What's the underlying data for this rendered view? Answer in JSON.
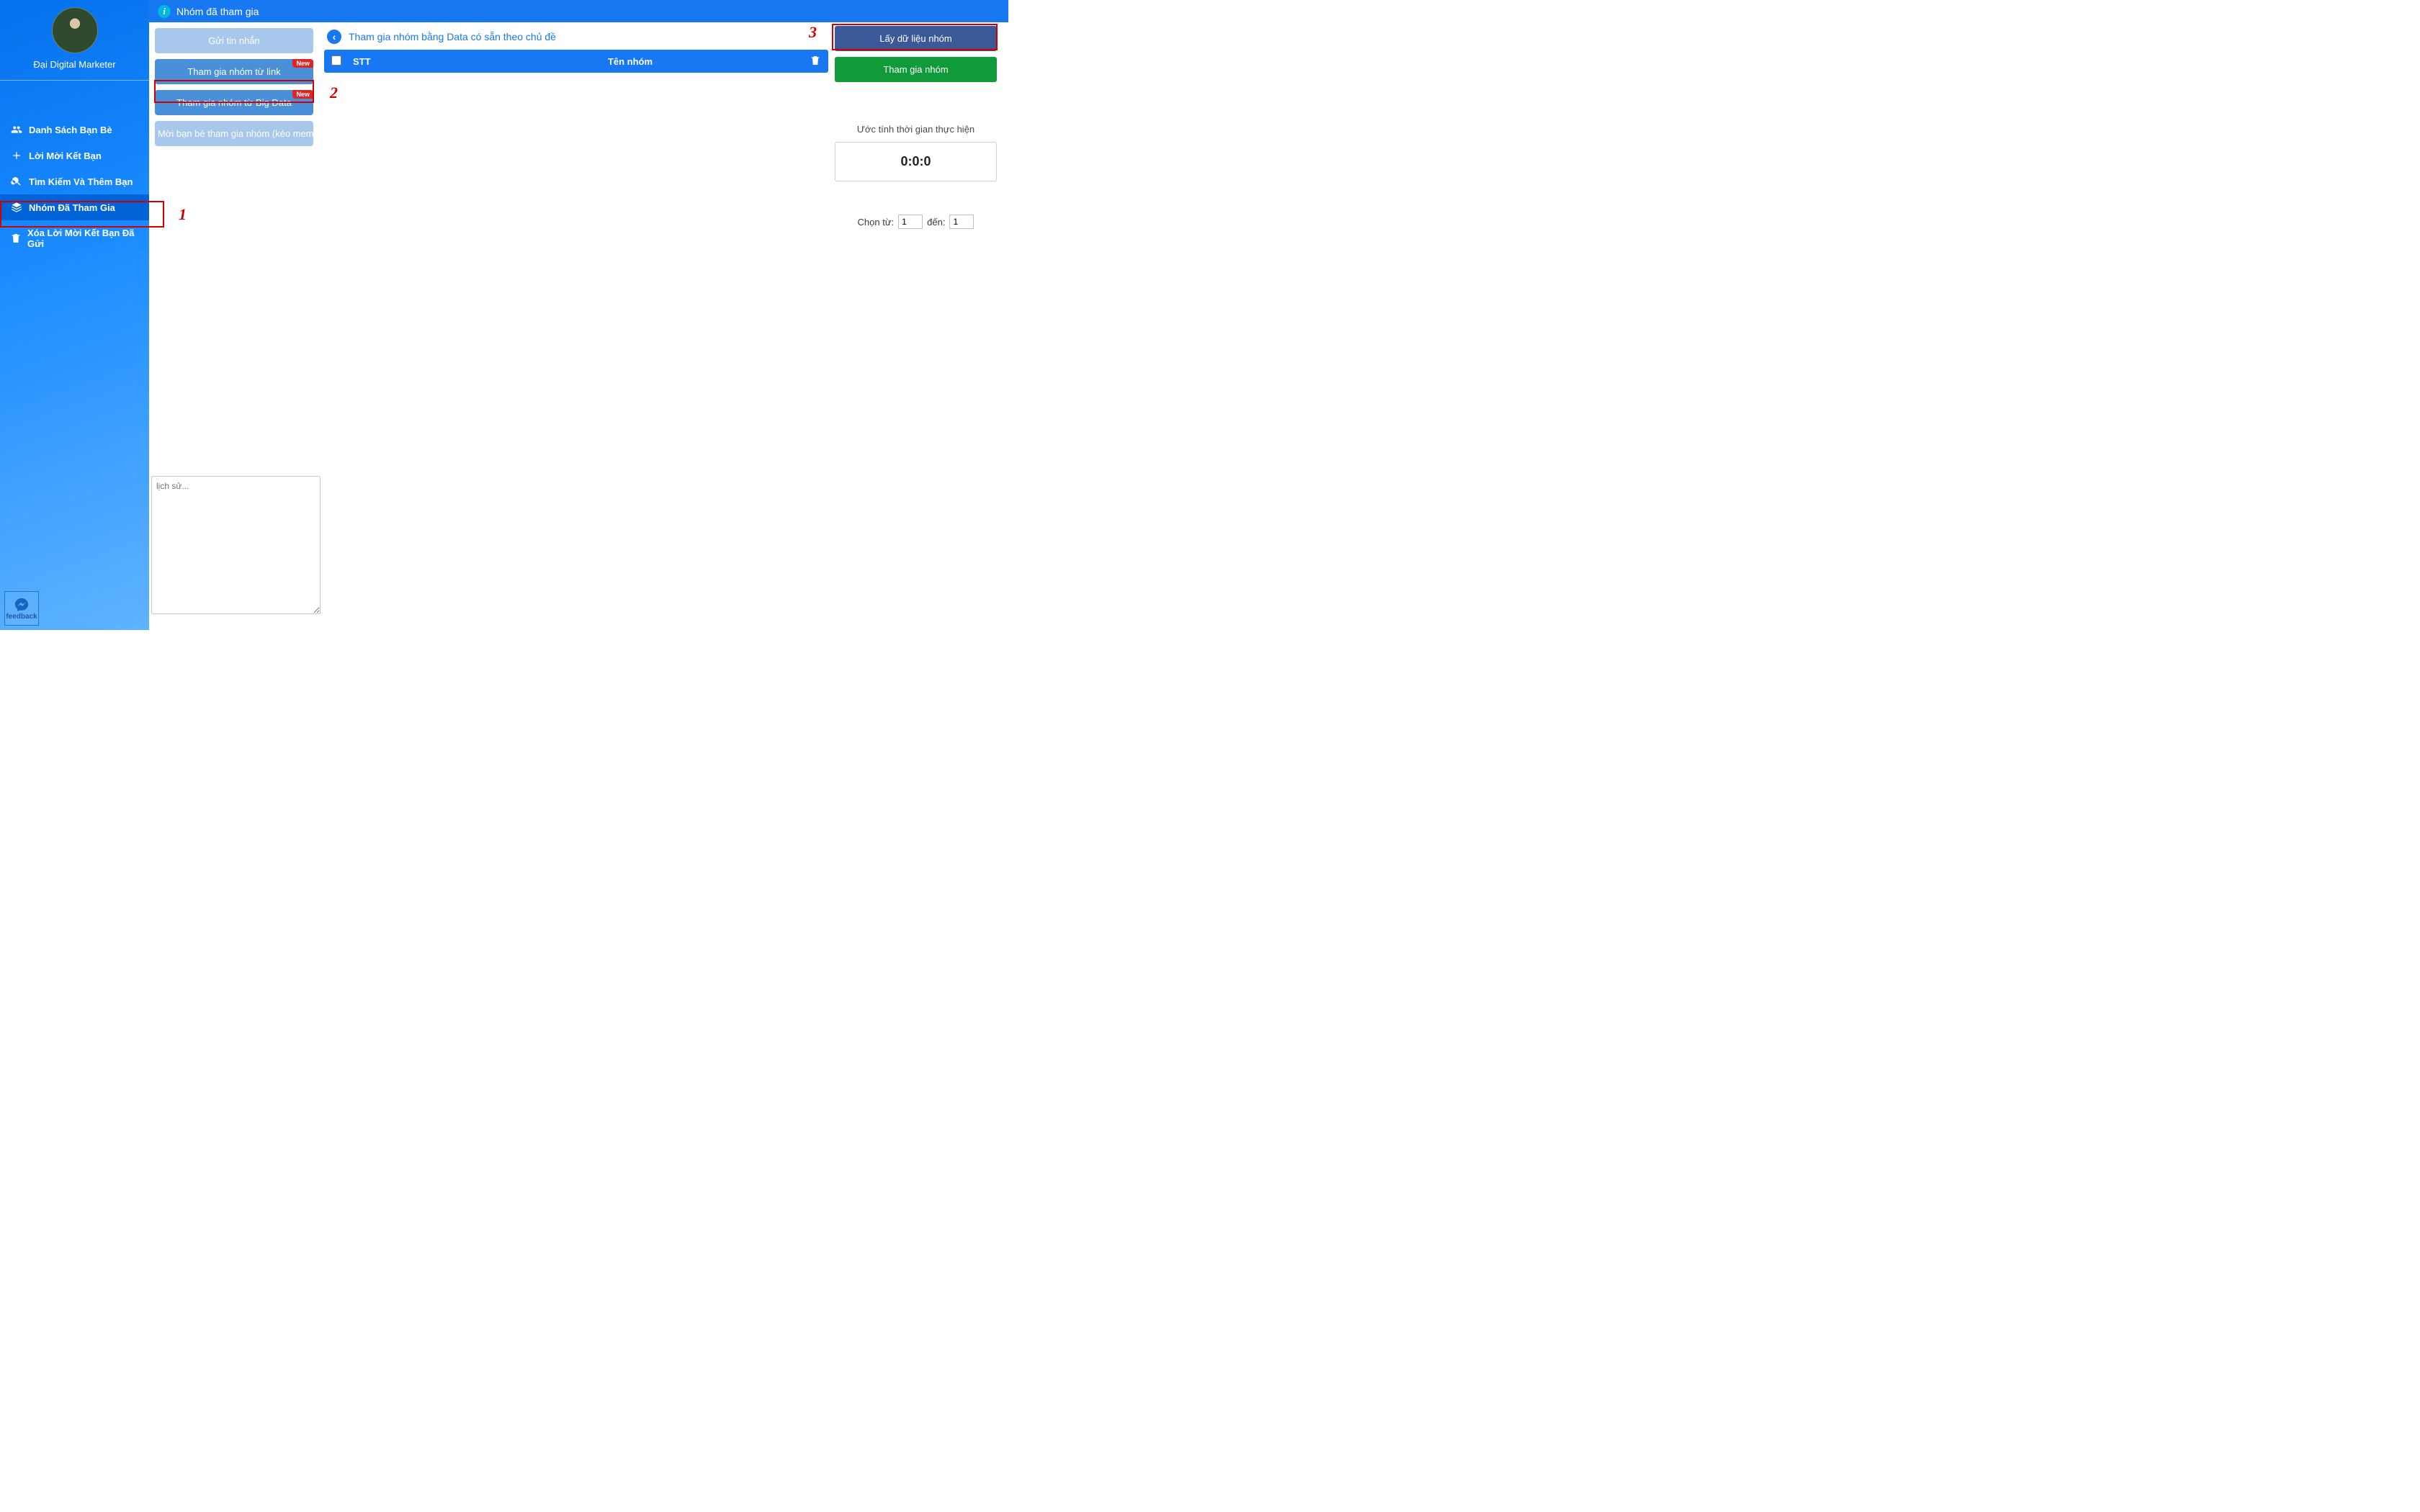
{
  "header": {
    "title": "Nhóm đã tham gia"
  },
  "user": {
    "name": "Đại Digital Marketer"
  },
  "sidebar": {
    "items": [
      {
        "label": "Danh Sách Bạn Bè"
      },
      {
        "label": "Lời Mời Kết Bạn"
      },
      {
        "label": "Tìm Kiếm Và Thêm Bạn"
      },
      {
        "label": "Nhóm Đã Tham Gia"
      },
      {
        "label": "Xóa Lời Mời Kết Bạn Đã Gửi"
      }
    ]
  },
  "submenu": {
    "send": "Gửi tin nhắn",
    "fromlink": "Tham gia nhóm từ link",
    "bigdata": "Tham gia nhóm từ Big Data",
    "invite": "Mời bạn bè tham gia nhóm (kéo member)",
    "new_badge": "New"
  },
  "main": {
    "breadcrumb": "Tham gia nhóm bằng Data có sẵn theo chủ đề",
    "table_headers": {
      "stt": "STT",
      "name": "Tên nhóm"
    }
  },
  "right": {
    "get_data": "Lấy dữ liệu nhóm",
    "join": "Tham gia nhóm",
    "estimate_label": "Ước tính thời gian thực hiện",
    "timer": "0:0:0",
    "range_from_label": "Chọn từ:",
    "range_to_label": "đến:",
    "range_from_value": "1",
    "range_to_value": "1"
  },
  "history": {
    "placeholder": "lịch sử..."
  },
  "feedback": {
    "label": "feedback"
  },
  "annotations": {
    "n1": "1",
    "n2": "2",
    "n3": "3"
  }
}
